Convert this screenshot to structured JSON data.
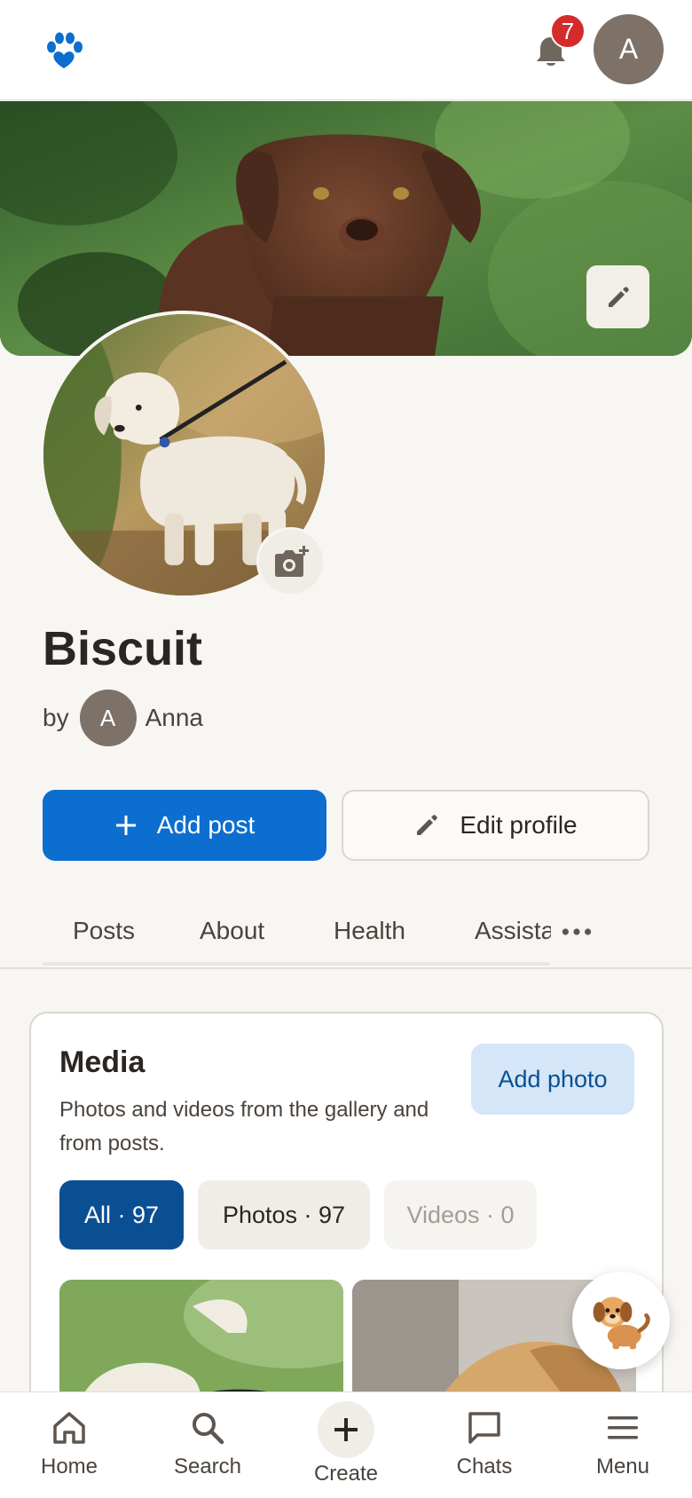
{
  "header": {
    "logo_icon": "paw-heart-icon",
    "notification_icon": "bell-icon",
    "notification_count": "7",
    "user_initial": "A"
  },
  "cover": {
    "edit_icon": "pencil-icon"
  },
  "profile": {
    "photo_add_icon": "camera-plus-icon",
    "name": "Biscuit",
    "by_label": "by",
    "owner_initial": "A",
    "owner_name": "Anna"
  },
  "actions": {
    "add_post_label": "Add post",
    "edit_profile_label": "Edit profile"
  },
  "tabs": [
    {
      "label": "Posts"
    },
    {
      "label": "About"
    },
    {
      "label": "Health"
    },
    {
      "label": "Assista"
    }
  ],
  "media": {
    "title": "Media",
    "description": "Photos and videos from the gallery and from posts.",
    "add_photo_label": "Add photo",
    "filters": [
      {
        "label": "All · 97",
        "selected": true
      },
      {
        "label": "Photos · 97",
        "selected": false
      },
      {
        "label": "Videos · 0",
        "selected": false,
        "disabled": true
      }
    ]
  },
  "bottom_nav": [
    {
      "label": "Home",
      "icon": "home-icon"
    },
    {
      "label": "Search",
      "icon": "search-icon"
    },
    {
      "label": "Create",
      "icon": "plus-icon"
    },
    {
      "label": "Chats",
      "icon": "chat-icon"
    },
    {
      "label": "Menu",
      "icon": "hamburger-icon"
    }
  ],
  "colors": {
    "primary": "#0c6ecf",
    "primary_dark": "#0b4f93",
    "background": "#f8f6f2",
    "badge": "#d42b2b",
    "avatar": "#7d7168"
  }
}
